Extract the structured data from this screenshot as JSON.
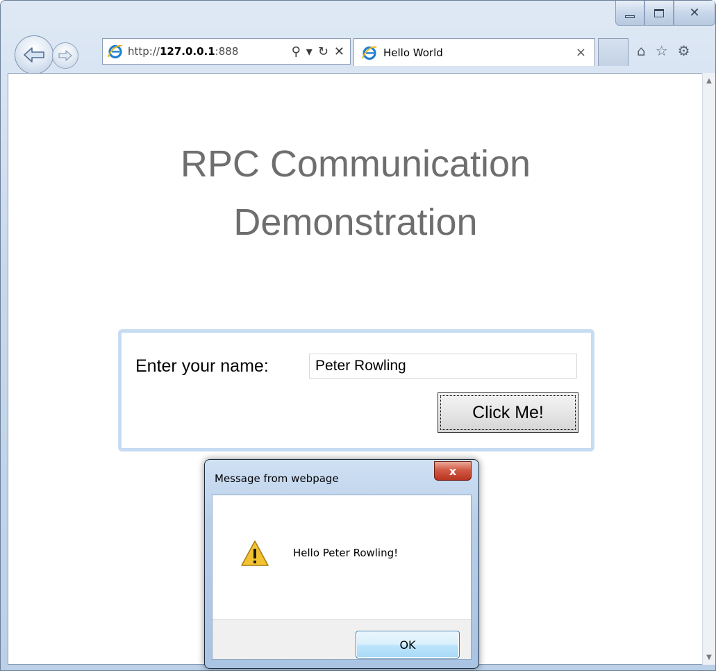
{
  "browser": {
    "address": {
      "scheme": "http://",
      "host": "127.0.0.1",
      "port": ":888"
    },
    "tab": {
      "title": "Hello World",
      "close_glyph": "×"
    },
    "icons": {
      "back": "back-arrow-icon",
      "forward": "forward-arrow-icon",
      "browser_logo": "internet-explorer-icon",
      "search": "search-icon",
      "dropdown": "dropdown-arrow-icon",
      "refresh": "refresh-icon",
      "stop": "stop-icon",
      "home": "home-icon",
      "favorites": "star-icon",
      "tools": "gear-icon"
    },
    "address_glyphs": {
      "search": "⚲",
      "dropdown": "▾",
      "refresh": "↻",
      "stop": "✕"
    },
    "toolbar_glyphs": {
      "home": "⌂",
      "favorites": "☆",
      "tools": "⚙"
    },
    "window_controls": {
      "close_glyph": "✕"
    }
  },
  "page": {
    "title_line1": "RPC Communication",
    "title_line2": "Demonstration",
    "form": {
      "label": "Enter your name:",
      "input_value": "Peter Rowling",
      "button_label": "Click Me!"
    }
  },
  "dialog": {
    "title": "Message from webpage",
    "close_glyph": "x",
    "message": "Hello Peter Rowling!",
    "ok_label": "OK",
    "icon": "warning-icon"
  },
  "colors": {
    "title_text": "#6e6e6e",
    "panel_border": "#c6dcf2",
    "dialog_close": "#c7432d",
    "warning": "#f2c230"
  }
}
